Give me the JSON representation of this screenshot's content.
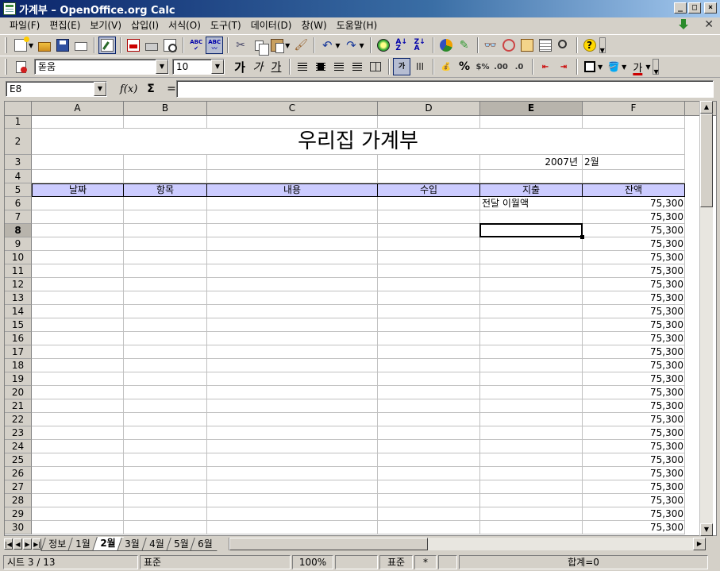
{
  "window": {
    "title": "가계부 – OpenOffice.org Calc"
  },
  "menu": [
    "파일(F)",
    "편집(E)",
    "보기(V)",
    "삽입(I)",
    "서식(O)",
    "도구(T)",
    "데이터(D)",
    "창(W)",
    "도움말(H)"
  ],
  "format_toolbar": {
    "font_name": "돋움",
    "font_size": "10",
    "bold_glyph": "가",
    "italic_glyph": "가",
    "underline_glyph": "가",
    "wrap_glyph": "가",
    "percent_glyph": "%",
    "currency_glyph": "$%",
    "font_color_glyph": "가"
  },
  "formula_bar": {
    "name_box": "E8",
    "fx_label": "f(x)",
    "sigma_label": "Σ",
    "equals_label": "=",
    "formula": ""
  },
  "grid": {
    "columns": [
      "A",
      "B",
      "C",
      "D",
      "E",
      "F"
    ],
    "selected_column": "E",
    "selected_row": 8,
    "rows": [
      1,
      2,
      3,
      4,
      5,
      6,
      7,
      8,
      9,
      10,
      11,
      12,
      13,
      14,
      15,
      16,
      17,
      18,
      19,
      20,
      21,
      22,
      23,
      24,
      25,
      26,
      27,
      28,
      29,
      30
    ],
    "title": "우리집 가계부",
    "date_year": "2007년",
    "date_month": "2월",
    "headers": [
      "날짜",
      "항목",
      "내용",
      "수입",
      "지출",
      "잔액"
    ],
    "carry_label": "전달 이월액",
    "balance": "75,300"
  },
  "sheet_tabs": [
    "정보",
    "1월",
    "2월",
    "3월",
    "4월",
    "5월",
    "6월"
  ],
  "active_tab": "2월",
  "status": {
    "sheet": "시트 3 / 13",
    "style": "표준",
    "zoom": "100%",
    "mode": "표준",
    "star": "*",
    "sum": "합계=0"
  }
}
